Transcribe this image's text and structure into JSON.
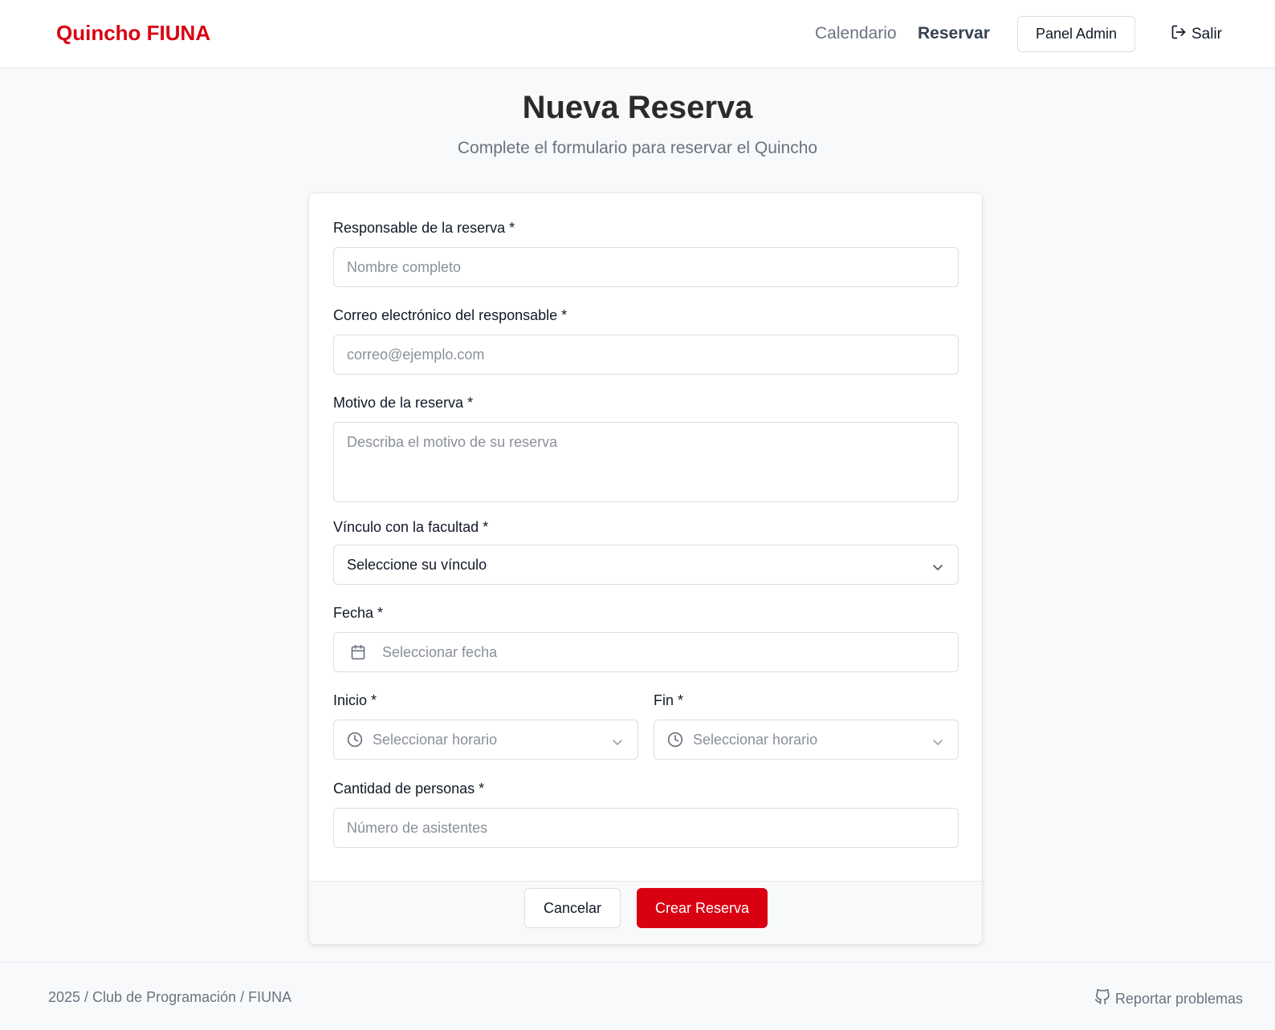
{
  "header": {
    "brand": "Quincho FIUNA",
    "nav": {
      "calendar": "Calendario",
      "reserve": "Reservar",
      "admin": "Panel Admin",
      "logout": "Salir"
    }
  },
  "page": {
    "title": "Nueva Reserva",
    "subtitle": "Complete el formulario para reservar el Quincho"
  },
  "form": {
    "responsible": {
      "label": "Responsable de la reserva *",
      "placeholder": "Nombre completo"
    },
    "email": {
      "label": "Correo electrónico del responsable *",
      "placeholder": "correo@ejemplo.com"
    },
    "reason": {
      "label": "Motivo de la reserva *",
      "placeholder": "Describa el motivo de su reserva"
    },
    "affiliation": {
      "label": "Vínculo con la facultad *",
      "selected": "Seleccione su vínculo"
    },
    "date": {
      "label": "Fecha *",
      "placeholder": "Seleccionar fecha"
    },
    "start": {
      "label": "Inicio *",
      "placeholder": "Seleccionar horario"
    },
    "end": {
      "label": "Fin *",
      "placeholder": "Seleccionar horario"
    },
    "people": {
      "label": "Cantidad de personas *",
      "placeholder": "Número de asistentes"
    },
    "buttons": {
      "cancel": "Cancelar",
      "create": "Crear Reserva"
    }
  },
  "footer": {
    "credits": "2025 / Club de Programación / FIUNA",
    "report": "Reportar problemas"
  },
  "colors": {
    "accent": "#d90012",
    "text_muted": "#6b7280",
    "border": "#d9dde3"
  },
  "icons": {
    "logout": "logout-icon",
    "calendar": "calendar-icon",
    "clock": "clock-icon",
    "chevron": "chevron-down-icon",
    "github": "github-icon"
  }
}
